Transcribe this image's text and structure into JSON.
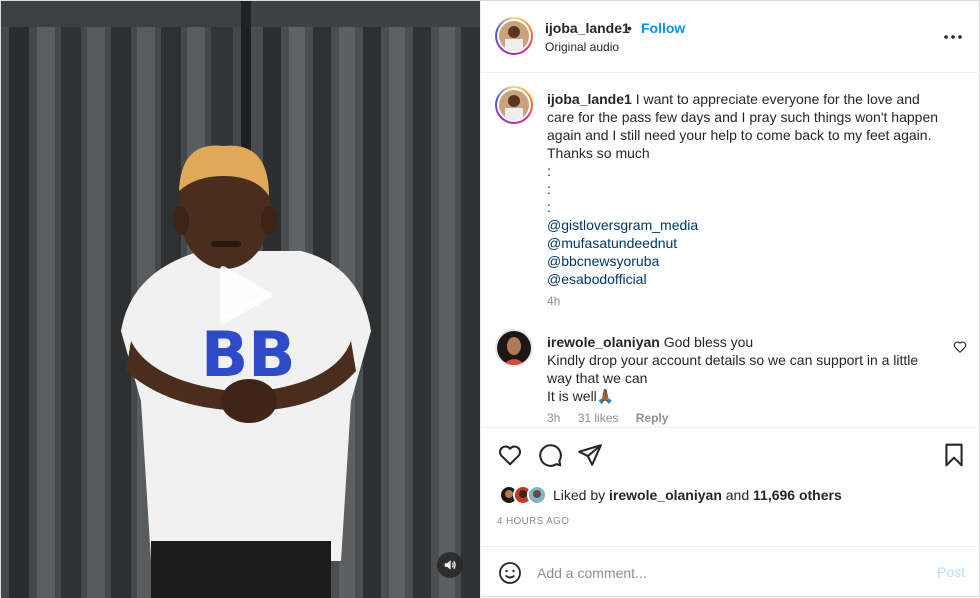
{
  "header": {
    "username": "ijoba_lande1",
    "separator": "•",
    "follow_label": "Follow",
    "audio": "Original audio",
    "more_icon": "more-horizontal-icon"
  },
  "caption": {
    "username": "ijoba_lande1",
    "text": "I want to appreciate everyone for the love and care for the pass few days and I pray such things won't happen again and I still need your help to come back to my feet again. Thanks so much",
    "dots": [
      ":",
      ":",
      ":"
    ],
    "mentions": [
      "@gistloversgram_media",
      "@mufasatundeednut",
      "@bbcnewsyoruba",
      "@esabodofficial"
    ],
    "time": "4h"
  },
  "comments": [
    {
      "username": "irewole_olaniyan",
      "lines": [
        "God bless you",
        "Kindly drop your account details so we can support in a little way that we can",
        "It is well🙏🏾"
      ],
      "time": "3h",
      "likes": "31 likes",
      "reply": "Reply"
    }
  ],
  "likes": {
    "prefix": "Liked by",
    "user": "irewole_olaniyan",
    "and": "and",
    "others": "11,696 others"
  },
  "time_ago": "4 HOURS AGO",
  "add_comment": {
    "placeholder": "Add a comment...",
    "post_label": "Post"
  },
  "colors": {
    "accent": "#0095f6",
    "mention": "#00376b",
    "muted": "#8e8e8e",
    "post_disabled": "#b2dffc"
  }
}
